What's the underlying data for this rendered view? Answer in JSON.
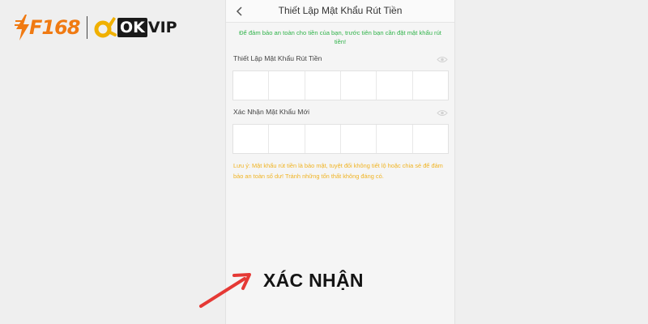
{
  "logo": {
    "brand1": "F168",
    "brand2_ok": "OK",
    "brand2_vip": "VIP"
  },
  "screen": {
    "title": "Thiết Lập Mật Khẩu Rút Tiền",
    "back_icon": "chevron-left-icon",
    "notice": "Để đảm bảo an toàn cho tiền của bạn, trước tiên bạn cần đặt mật khẩu rút tiền!",
    "fields": [
      {
        "label": "Thiết Lập Mật Khẩu Rút Tiền",
        "cells": 6,
        "toggle_icon": "eye-icon"
      },
      {
        "label": "Xác Nhận Mật Khẩu Mới",
        "cells": 6,
        "toggle_icon": "eye-icon"
      }
    ],
    "warning": "Lưu ý: Mật khẩu rút tiền là bảo mật, tuyệt đối không tiết lộ hoặc chia sẻ để đảm bảo an toàn số dư! Tránh những tổn thất không đáng có."
  },
  "annotation": {
    "label": "XÁC NHẬN",
    "arrow_color": "#e53935"
  },
  "colors": {
    "notice": "#31b34b",
    "warning": "#f0b322",
    "brand_orange": "#f07a12"
  }
}
